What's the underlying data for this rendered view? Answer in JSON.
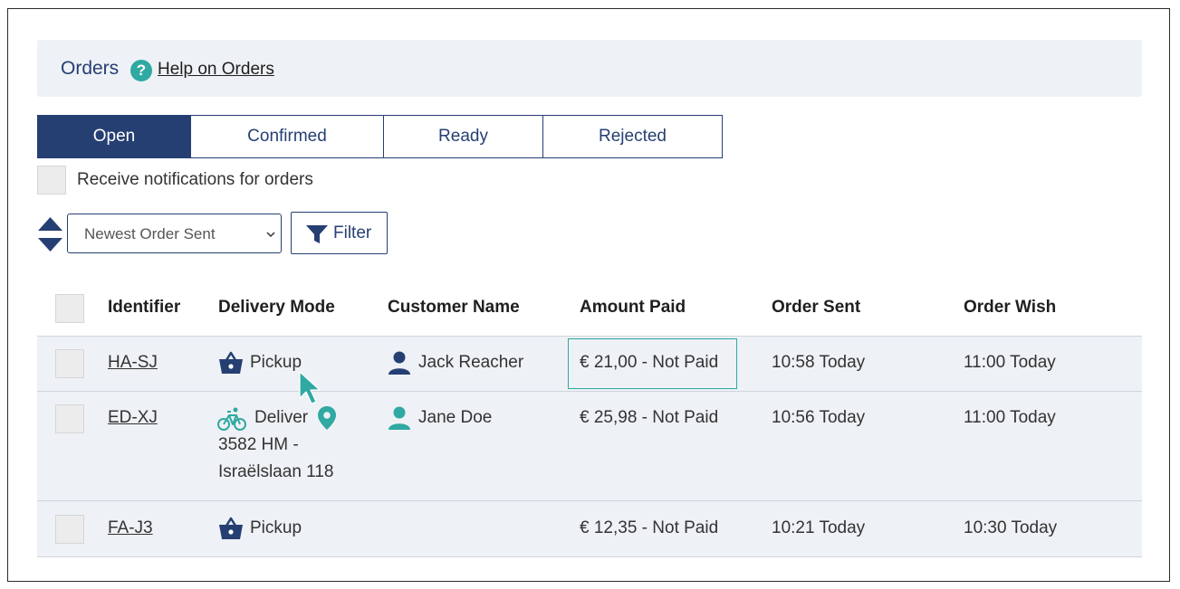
{
  "header": {
    "title": "Orders",
    "help_link": "Help on Orders"
  },
  "tabs": [
    {
      "label": "Open",
      "active": true
    },
    {
      "label": "Confirmed",
      "active": false
    },
    {
      "label": "Ready",
      "active": false
    },
    {
      "label": "Rejected",
      "active": false
    }
  ],
  "notifications": {
    "label": "Receive notifications for orders",
    "checked": false
  },
  "sort": {
    "selected": "Newest Order Sent"
  },
  "filter": {
    "label": "Filter"
  },
  "table": {
    "columns": [
      "Identifier",
      "Delivery Mode",
      "Customer Name",
      "Amount Paid",
      "Order Sent",
      "Order Wish"
    ],
    "rows": [
      {
        "identifier": "HA-SJ",
        "delivery_mode": "Pickup",
        "delivery_icon": "basket-icon",
        "address_line1": "",
        "address_line2": "",
        "customer": "Jack Reacher",
        "amount": "€ 21,00 - Not Paid",
        "order_sent": "10:58 Today",
        "order_wish": "11:00 Today"
      },
      {
        "identifier": "ED-XJ",
        "delivery_mode": "Deliver",
        "delivery_icon": "bicycle-icon",
        "address_line1": "3582 HM -",
        "address_line2": "Israëlslaan 118",
        "customer": "Jane Doe",
        "amount": "€ 25,98 - Not Paid",
        "order_sent": "10:56 Today",
        "order_wish": "11:00 Today"
      },
      {
        "identifier": "FA-J3",
        "delivery_mode": "Pickup",
        "delivery_icon": "basket-icon",
        "address_line1": "",
        "address_line2": "",
        "customer": "",
        "amount": "€ 12,35 - Not Paid",
        "order_sent": "10:21 Today",
        "order_wish": "10:30 Today"
      }
    ]
  },
  "colors": {
    "primary": "#263f73",
    "accent": "#2fa9a2",
    "row_bg": "#eef1f5"
  }
}
